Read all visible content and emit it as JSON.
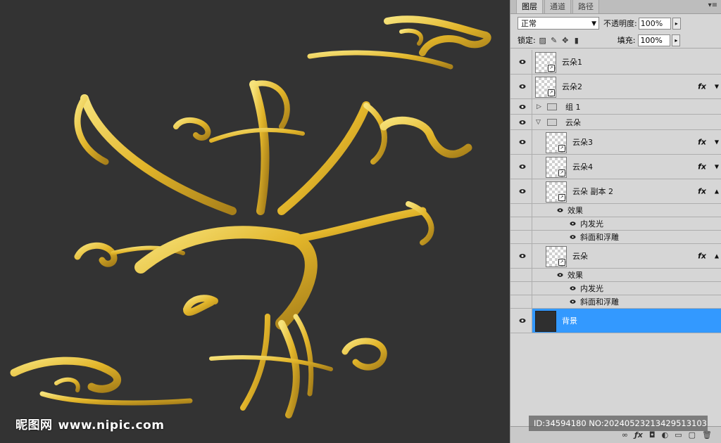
{
  "watermark": {
    "logo_text": "昵图网",
    "url": "www.nipic.com"
  },
  "id_bar": "ID:34594180 NO:20240523213429513103",
  "panel": {
    "tabs": [
      "图层",
      "通道",
      "路径"
    ],
    "active_tab": 0,
    "blend_mode": "正常",
    "opacity_label": "不透明度:",
    "opacity_value": "100%",
    "lock_label": "锁定:",
    "fill_label": "填充:",
    "fill_value": "100%"
  },
  "layers": [
    {
      "id": "l1",
      "name": "云朵1",
      "type": "layer",
      "fx": false
    },
    {
      "id": "l2",
      "name": "云朵2",
      "type": "layer",
      "fx": true,
      "fx_label": "fx"
    },
    {
      "id": "g1",
      "name": "组 1",
      "type": "group",
      "expanded": false
    },
    {
      "id": "g2",
      "name": "云朵",
      "type": "group",
      "expanded": true
    },
    {
      "id": "l3",
      "name": "云朵3",
      "type": "layer",
      "fx": true,
      "fx_label": "fx"
    },
    {
      "id": "l4",
      "name": "云朵4",
      "type": "layer",
      "fx": true,
      "fx_label": "fx"
    },
    {
      "id": "l5",
      "name": "云朵 副本 2",
      "type": "layer",
      "fx": true,
      "fx_label": "fx",
      "effects_label": "效果",
      "effects": [
        "内发光",
        "斜面和浮雕"
      ]
    },
    {
      "id": "l6",
      "name": "云朵",
      "type": "layer",
      "fx": true,
      "fx_label": "fx",
      "effects_label": "效果",
      "effects": [
        "内发光",
        "斜面和浮雕"
      ]
    },
    {
      "id": "bg",
      "name": "背景",
      "type": "background",
      "selected": true
    }
  ],
  "colors": {
    "canvas_bg": "#333333",
    "gold": "#e7c43a",
    "selection": "#3399ff"
  }
}
